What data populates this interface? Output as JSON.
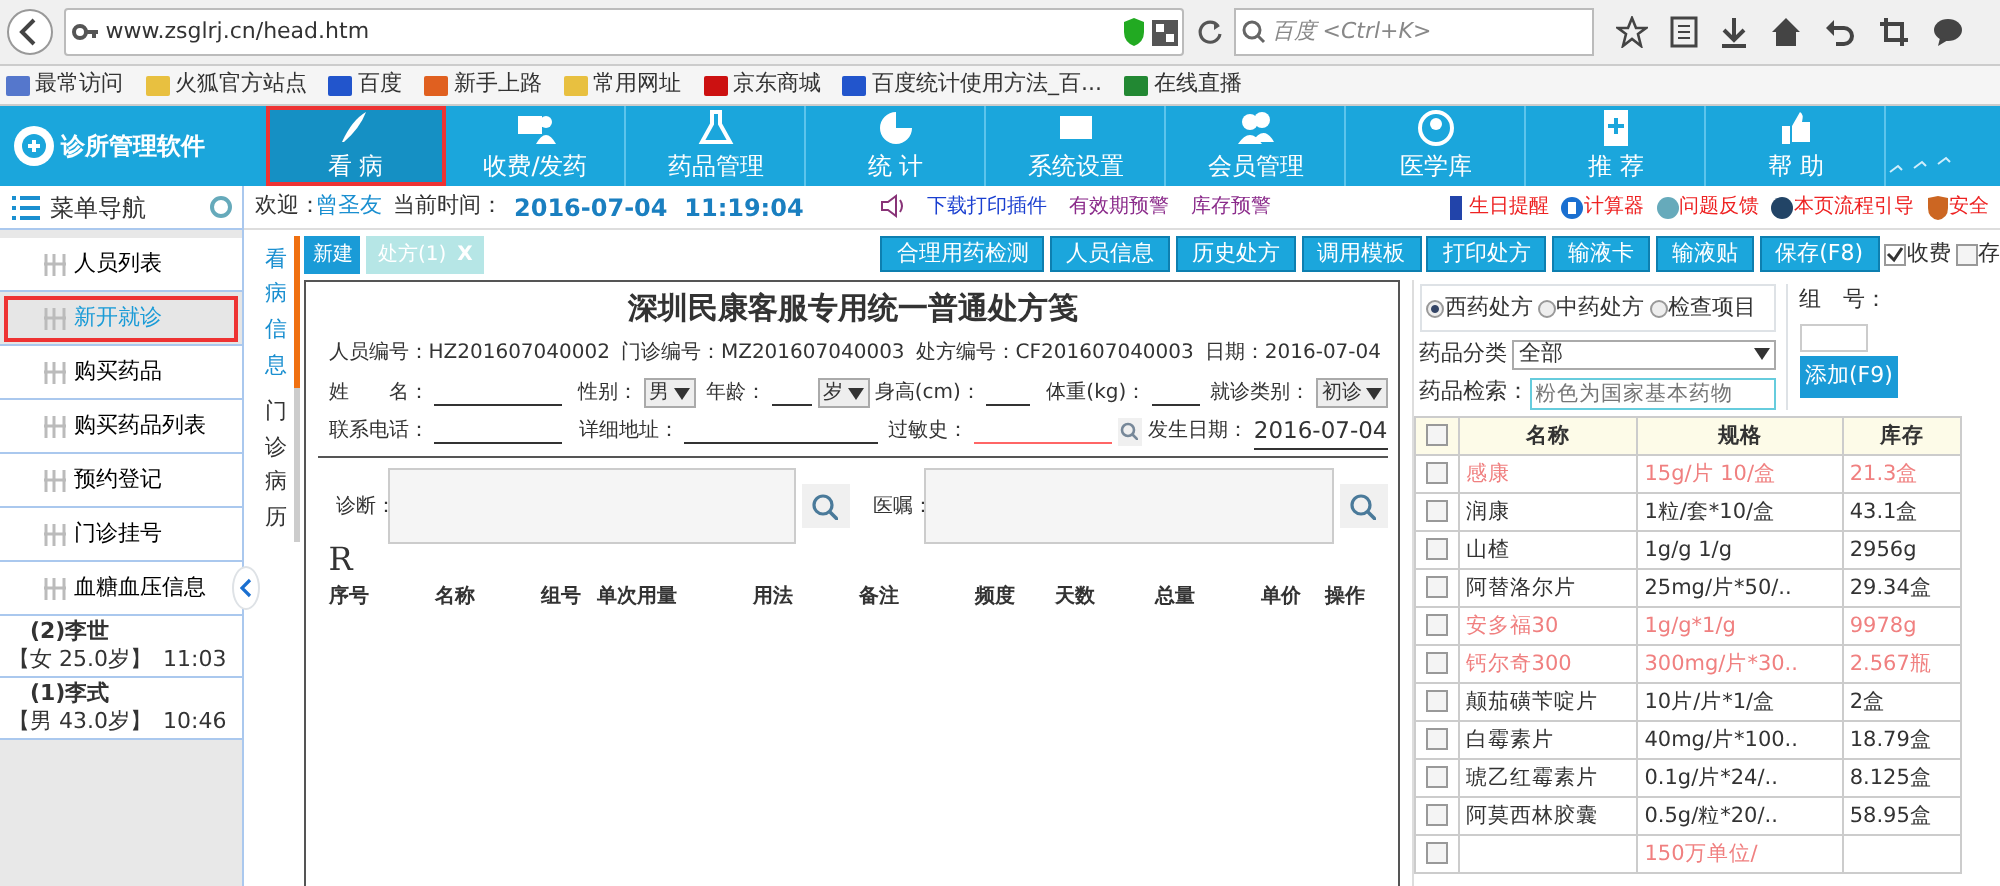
{
  "browser": {
    "url": "www.zsglrj.cn/head.htm",
    "search_placeholder": "百度 <Ctrl+K>",
    "bookmarks": [
      "最常访问",
      "火狐官方站点",
      "百度",
      "新手上路",
      "常用网址",
      "京东商城",
      "百度统计使用方法_百...",
      "在线直播"
    ]
  },
  "app": {
    "title": "诊所管理软件",
    "nav": [
      {
        "label": "看 病",
        "selected": true
      },
      {
        "label": "收费/发药",
        "selected": false
      },
      {
        "label": "药品管理",
        "selected": false
      },
      {
        "label": "统 计",
        "selected": false
      },
      {
        "label": "系统设置",
        "selected": false
      },
      {
        "label": "会员管理",
        "selected": false
      },
      {
        "label": "医学库",
        "selected": false
      },
      {
        "label": "推 荐",
        "selected": false
      },
      {
        "label": "帮 助",
        "selected": false
      }
    ]
  },
  "sidebar": {
    "title": "菜单导航",
    "items": [
      {
        "label": "人员列表",
        "selected": false
      },
      {
        "label": "新开就诊",
        "selected": true
      },
      {
        "label": "购买药品",
        "selected": false
      },
      {
        "label": "购买药品列表",
        "selected": false
      },
      {
        "label": "预约登记",
        "selected": false
      },
      {
        "label": "门诊挂号",
        "selected": false
      },
      {
        "label": "血糖血压信息",
        "selected": false
      }
    ],
    "patients": [
      {
        "name": "(2)李世",
        "info": "【女 25.0岁】",
        "time": "11:03"
      },
      {
        "name": "(1)李式",
        "info": "【男 43.0岁】",
        "time": "10:46"
      }
    ]
  },
  "status": {
    "welcome": "欢迎：",
    "user": "曾圣友",
    "time_label": "当前时间：",
    "time": "2016-07-04  11:19:04",
    "links": [
      {
        "label": "下载打印插件",
        "color": "#1a3fd0"
      },
      {
        "label": "有效期预警",
        "color": "#8a2a8a"
      },
      {
        "label": "库存预警",
        "color": "#8a2a8a"
      }
    ],
    "tools": [
      {
        "label": "生日提醒"
      },
      {
        "label": "计算器"
      },
      {
        "label": "问题反馈"
      },
      {
        "label": "本页流程引导"
      },
      {
        "label": "安全"
      }
    ]
  },
  "side_tabs": [
    {
      "label": "看病信息",
      "selected": true
    },
    {
      "label": "门诊病历",
      "selected": false
    }
  ],
  "new_button": "新建",
  "doc_tab": {
    "label": "处方(1)",
    "close": "X"
  },
  "toolbar_buttons": [
    "合理用药检测",
    "人员信息",
    "历史处方",
    "调用模板",
    "打印处方",
    "输液卡",
    "输液贴",
    "保存(F8)"
  ],
  "toolbar_checks": [
    {
      "label": "收费",
      "checked": true
    },
    {
      "label": "存",
      "checked": false
    }
  ],
  "form": {
    "title": "深圳民康客服专用统一普通处方笺",
    "ids": [
      {
        "label": "人员编号：",
        "value": "HZ201607040002"
      },
      {
        "label": "门诊编号：",
        "value": "MZ201607040003"
      },
      {
        "label": "处方编号：",
        "value": "CF201607040003"
      },
      {
        "label": "日期：",
        "value": "2016-07-04"
      }
    ],
    "name_label": "姓　　名：",
    "gender_label": "性别：",
    "gender": "男",
    "age_label": "年龄：",
    "age_unit": "岁",
    "height_label": "身高(cm)：",
    "weight_label": "体重(kg)：",
    "visit_label": "就诊类别：",
    "visit": "初诊",
    "phone_label": "联系电话：",
    "address_label": "详细地址：",
    "allergy_label": "过敏史：",
    "date_label": "发生日期：",
    "date": "2016-07-04",
    "diagnosis_label": "诊断：",
    "advice_label": "医嘱：",
    "rx": "R",
    "columns": [
      "序号",
      "名称",
      "组号",
      "单次用量",
      "用法",
      "备注",
      "频度",
      "天数",
      "总量",
      "单价",
      "操作"
    ]
  },
  "drugs": {
    "types": [
      {
        "label": "西药处方",
        "selected": true
      },
      {
        "label": "中药处方",
        "selected": false
      },
      {
        "label": "检查项目",
        "selected": false
      }
    ],
    "category_label": "药品分类",
    "category": "全部",
    "search_label": "药品检索：",
    "search_placeholder": "粉色为国家基本药物",
    "group_label": "组　号：",
    "add_button": "添加(F9)",
    "columns": [
      "名称",
      "规格",
      "库存"
    ],
    "all_checked": false,
    "rows": [
      {
        "name": "感康",
        "spec": "15g/片 10/盒",
        "stock": "21.3盒",
        "essential": true,
        "checked": false
      },
      {
        "name": "润康",
        "spec": "1粒/套*10/盒",
        "stock": "43.1盒",
        "essential": false,
        "checked": false
      },
      {
        "name": "山楂",
        "spec": "1g/g 1/g",
        "stock": "2956g",
        "essential": false,
        "checked": false
      },
      {
        "name": "阿替洛尔片",
        "spec": "25mg/片*50/..",
        "stock": "29.34盒",
        "essential": false,
        "checked": false
      },
      {
        "name": "安多福30",
        "spec": "1g/g*1/g",
        "stock": "9978g",
        "essential": true,
        "checked": false
      },
      {
        "name": "钙尔奇300",
        "spec": "300mg/片*30..",
        "stock": "2.567瓶",
        "essential": true,
        "checked": false
      },
      {
        "name": "颠茄磺苄啶片",
        "spec": "10片/片*1/盒",
        "stock": "2盒",
        "essential": false,
        "checked": false
      },
      {
        "name": "白霉素片",
        "spec": "40mg/片*100..",
        "stock": "18.79盒",
        "essential": false,
        "checked": false
      },
      {
        "name": "琥乙红霉素片",
        "spec": "0.1g/片*24/..",
        "stock": "8.125盒",
        "essential": false,
        "checked": false
      },
      {
        "name": "阿莫西林胶囊",
        "spec": "0.5g/粒*20/..",
        "stock": "58.95盒",
        "essential": false,
        "checked": false
      },
      {
        "spec": "150万单位/",
        "essential": true,
        "checked": false
      }
    ]
  }
}
